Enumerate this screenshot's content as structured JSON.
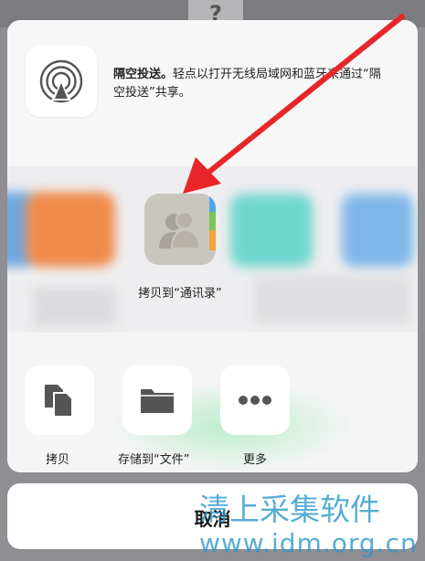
{
  "airdrop": {
    "icon": "airdrop-icon",
    "title": "隔空投送。",
    "description": "轻点以打开无线局域网和蓝牙来通过“隔空投送”共享。"
  },
  "apps": {
    "contacts": {
      "icon": "contacts-icon",
      "label": "拷贝到“通讯录”"
    }
  },
  "actions": [
    {
      "icon": "copy-icon",
      "label": "拷贝"
    },
    {
      "icon": "folder-icon",
      "label": "存储到“文件”"
    },
    {
      "icon": "more-icon",
      "label": "更多"
    }
  ],
  "cancel": {
    "label": "取消"
  },
  "watermark": {
    "line1": "清上采集软件",
    "line2": "www.idm.org.cn"
  },
  "backdrop": {
    "glyph": "?"
  },
  "colors": {
    "annotation_arrow": "#e8262a",
    "contacts_tab_blue": "#4fa6e4",
    "contacts_tab_green": "#7cc553",
    "contacts_tab_orange": "#f3a53b"
  }
}
